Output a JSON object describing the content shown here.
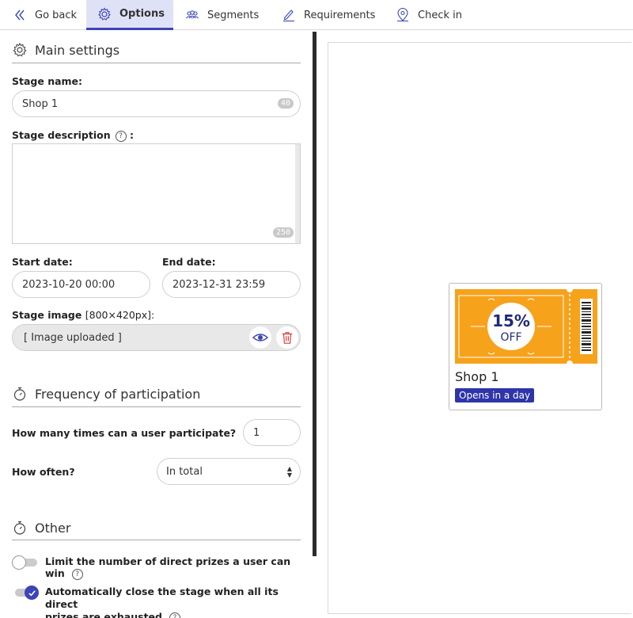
{
  "nav": {
    "back": "Go back",
    "options": "Options",
    "segments": "Segments",
    "requirements": "Requirements",
    "checkin": "Check in"
  },
  "main_settings": {
    "title": "Main settings",
    "stage_name_label": "Stage name:",
    "stage_name_value": "Shop 1",
    "stage_name_counter": "40",
    "description_label": "Stage description",
    "description_colon": ":",
    "description_counter": "250",
    "start_label": "Start date:",
    "start_value": "2023-10-20 00:00",
    "end_label": "End date:",
    "end_value": "2023-12-31 23:59",
    "image_label": "Stage image",
    "image_size": "[800×420px]:",
    "image_value": "[ Image uploaded ]"
  },
  "frequency": {
    "title": "Frequency of participation",
    "times_label": "How many times can a user participate?",
    "times_value": "1",
    "often_label": "How often?",
    "often_value": "In total"
  },
  "other": {
    "title": "Other",
    "limit_label": "Limit the number of direct prizes a user can win",
    "limit_on": false,
    "autoclose_label_1": "Automatically close the stage when all its direct",
    "autoclose_label_2": "prizes are exhausted",
    "autoclose_on": true
  },
  "preview": {
    "coupon_percent": "15%",
    "coupon_off": "OFF",
    "title": "Shop 1",
    "badge": "Opens in a day"
  },
  "colors": {
    "accent": "#3c45b6",
    "coupon": "#f7a21b",
    "badge": "#2e35a8"
  }
}
